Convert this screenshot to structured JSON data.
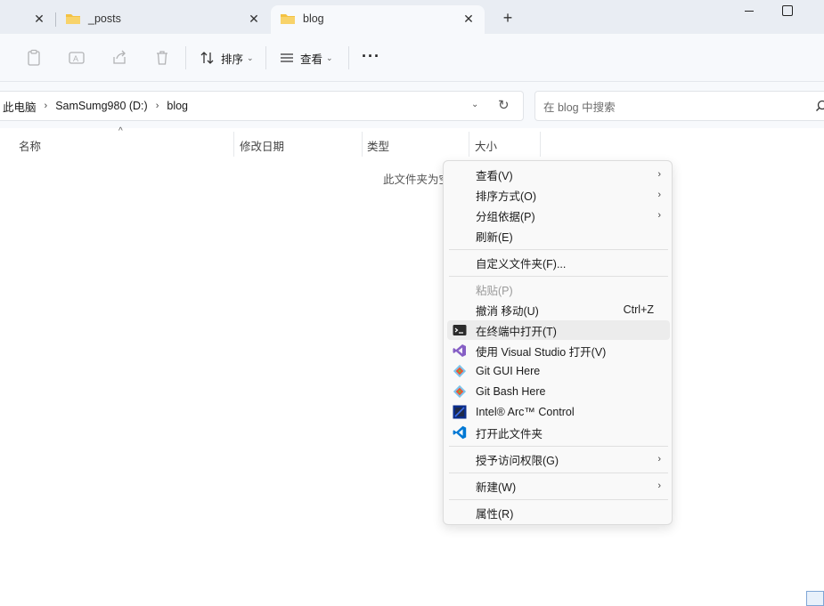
{
  "tabs": [
    {
      "label": ""
    },
    {
      "label": "_posts"
    },
    {
      "label": "blog"
    }
  ],
  "toolbar": {
    "sort_label": "排序",
    "view_label": "查看"
  },
  "address": {
    "crumbs": [
      "此电脑",
      "SamSumg980 (D:)",
      "blog"
    ]
  },
  "search": {
    "placeholder": "在 blog 中搜索"
  },
  "columns": [
    "名称",
    "修改日期",
    "类型",
    "大小"
  ],
  "empty_message": "此文件夹为空。",
  "context_menu": {
    "view": "查看(V)",
    "sort": "排序方式(O)",
    "group": "分组依据(P)",
    "refresh": "刷新(E)",
    "customize": "自定义文件夹(F)...",
    "paste": "粘贴(P)",
    "undo": "撤消 移动(U)",
    "undo_shortcut": "Ctrl+Z",
    "open_terminal": "在终端中打开(T)",
    "open_vs": "使用 Visual Studio 打开(V)",
    "git_gui": "Git GUI Here",
    "git_bash": "Git Bash Here",
    "intel_arc": "Intel® Arc™ Control",
    "open_folder": "打开此文件夹",
    "grant_access": "授予访问权限(G)",
    "new": "新建(W)",
    "properties": "属性(R)"
  },
  "colors": {
    "folder": "#f4c242",
    "vs_purple": "#865fc5",
    "git_orange": "#f05033",
    "vscode_blue": "#0078d4",
    "intel_blue": "#0b2d8a"
  }
}
